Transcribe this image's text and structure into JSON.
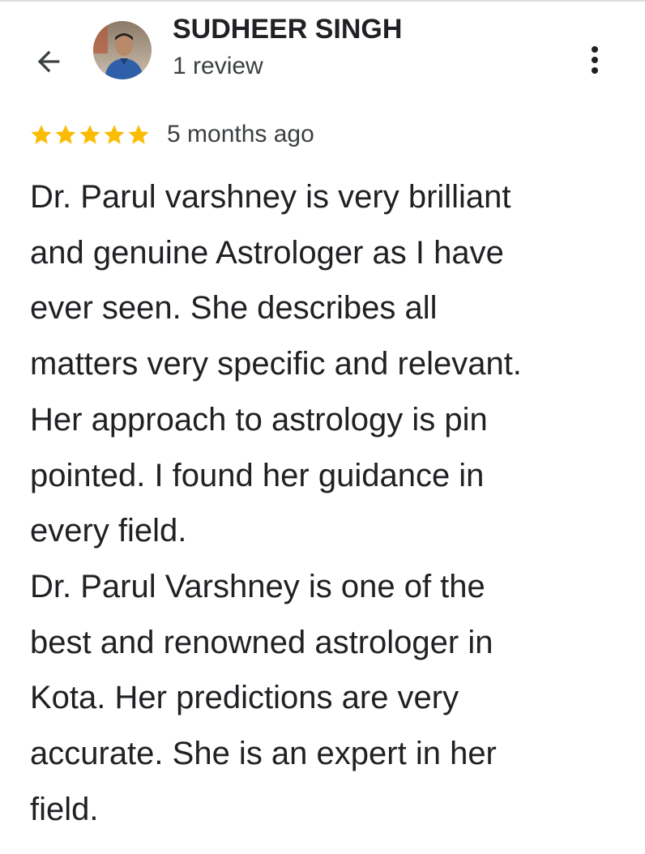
{
  "header": {
    "reviewer_name": "SUDHEER SINGH",
    "review_count": "1 review",
    "back_icon": "arrow-left-icon",
    "more_icon": "more-vertical-icon"
  },
  "rating": {
    "stars": 5,
    "max_stars": 5,
    "star_color": "#FBBC04",
    "time_ago": "5 months ago"
  },
  "review": {
    "lines": [
      "Dr. Parul varshney is very brilliant",
      "and genuine Astrologer as I have",
      "ever seen. She describes all",
      "matters very specific and relevant.",
      "Her approach to astrology is pin",
      "pointed. I found her guidance in",
      "every field.",
      "Dr. Parul Varshney is one of the",
      "best and renowned astrologer in",
      "Kota. Her predictions are very",
      "accurate. She is an expert in her",
      "field."
    ]
  }
}
